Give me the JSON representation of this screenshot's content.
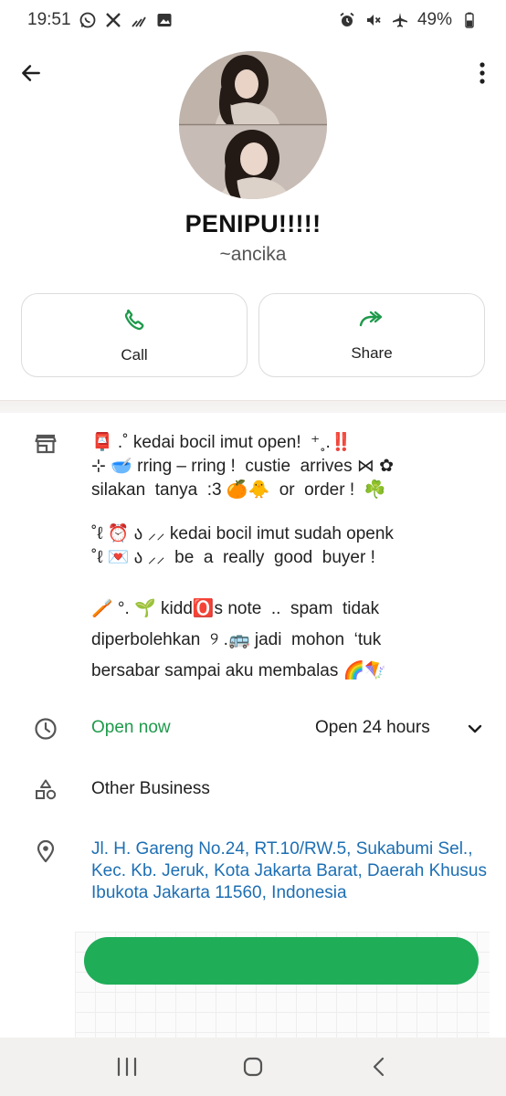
{
  "status_bar": {
    "time": "19:51",
    "battery": "49%",
    "left_icons": [
      "whatsapp-icon",
      "x-icon",
      "signal-icon",
      "gallery-icon"
    ],
    "right_icons": [
      "alarm-icon",
      "mute-icon",
      "airplane-icon",
      "battery-icon"
    ]
  },
  "profile": {
    "name": "PENIPU!!!!!",
    "handle": "~ancika"
  },
  "actions": {
    "call_label": "Call",
    "share_label": "Share",
    "accent_color": "#1e9a4b"
  },
  "description": {
    "p1_l1": "📮 .˚ kedai bocil imut open!  ⁺˳.‼️",
    "p1_l2": "⊹ 🥣 rring – rring !  custie  arrives ⋈ ✿",
    "p1_l3": "silakan  tanya  :3 🍊🐥  or  order !  ☘️",
    "p2_l1": "˚ℓ ⏰ ა ⸝⸝ kedai bocil imut sudah openk",
    "p2_l2": "˚ℓ 💌 ა ⸝⸝  be  a  really  good  buyer !",
    "p3_l1": "🪥 °. 🌱 kidd🅾️s note  ..  spam  tidak",
    "p3_l2": "diperbolehkan  ୨ .🚌 jadi  mohon  ‘tuk",
    "p3_l3": "bersabar sampai aku membalas 🌈🪁"
  },
  "hours": {
    "status": "Open now",
    "text": "Open 24 hours",
    "status_color": "#1e9a4b"
  },
  "category": "Other Business",
  "address": "Jl. H. Gareng No.24, RT.10/RW.5, Sukabumi Sel., Kec. Kb. Jeruk, Kota Jakarta Barat, Daerah Khusus Ibukota Jakarta 11560, Indonesia",
  "colors": {
    "link": "#1d6fb3",
    "primary_button": "#1fad58"
  }
}
